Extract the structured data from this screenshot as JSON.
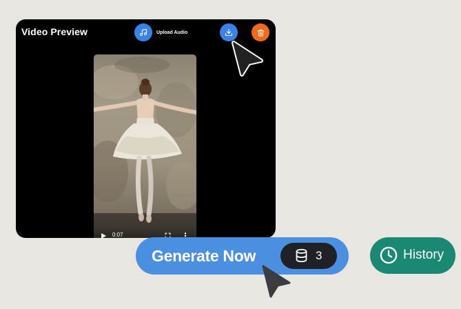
{
  "preview": {
    "title": "Video Preview",
    "upload_audio_label": "Upload Audio",
    "upload_audio_icon": "music-note-icon",
    "download_icon": "download-icon",
    "delete_icon": "trash-icon"
  },
  "video": {
    "current_time": "0:07",
    "play_icon": "play-icon",
    "fullscreen_icon": "fullscreen-icon",
    "more_icon": "more-vertical-icon"
  },
  "actions": {
    "generate_label": "Generate Now",
    "credits_icon": "database-icon",
    "credits_count": "3",
    "history_label": "History",
    "history_icon": "clock-icon"
  },
  "colors": {
    "background": "#e8e6e0",
    "accent_blue": "#4a8fe0",
    "icon_blue": "#3b82e8",
    "delete_orange": "#f26a1b",
    "history_green": "#1a8873",
    "credits_dark": "#1e2126"
  }
}
